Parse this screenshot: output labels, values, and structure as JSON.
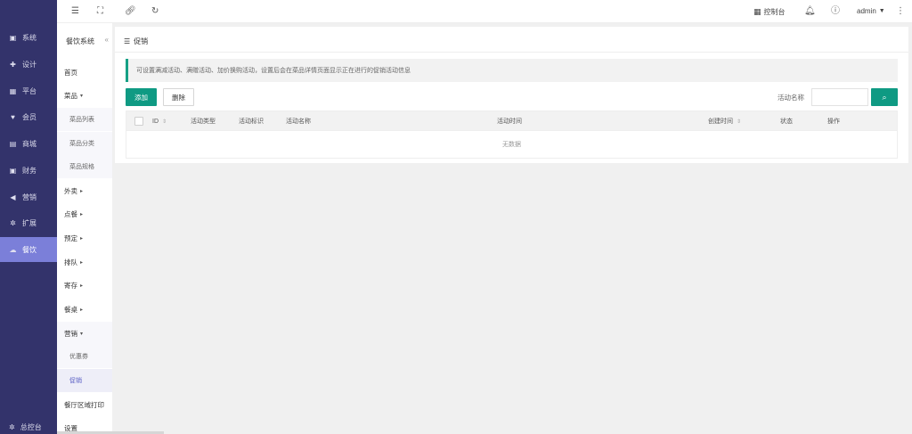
{
  "leftnav": {
    "items": [
      {
        "label": "系统",
        "icon": "monitor-icon"
      },
      {
        "label": "设计",
        "icon": "puzzle-icon"
      },
      {
        "label": "平台",
        "icon": "grid-icon"
      },
      {
        "label": "会员",
        "icon": "heart-icon"
      },
      {
        "label": "商城",
        "icon": "shop-icon"
      },
      {
        "label": "财务",
        "icon": "wallet-icon"
      },
      {
        "label": "营销",
        "icon": "megaphone-icon"
      },
      {
        "label": "扩展",
        "icon": "gear-icon"
      },
      {
        "label": "餐饮",
        "icon": "cloud-icon"
      }
    ],
    "active_index": 8,
    "bottom_label": "总控台"
  },
  "subnav": {
    "title": "餐饮系统",
    "collapse": "«",
    "items": [
      {
        "label": "首页",
        "type": "item"
      },
      {
        "label": "菜品",
        "type": "group",
        "caret": "▾"
      },
      {
        "label": "菜品列表",
        "type": "child"
      },
      {
        "label": "菜品分类",
        "type": "child"
      },
      {
        "label": "菜品规格",
        "type": "child"
      },
      {
        "label": "外卖",
        "type": "group",
        "caret": "▸"
      },
      {
        "label": "点餐",
        "type": "group",
        "caret": "▸"
      },
      {
        "label": "预定",
        "type": "group",
        "caret": "▸"
      },
      {
        "label": "排队",
        "type": "group",
        "caret": "▸"
      },
      {
        "label": "寄存",
        "type": "group",
        "caret": "▸"
      },
      {
        "label": "餐桌",
        "type": "group",
        "caret": "▸"
      },
      {
        "label": "营销",
        "type": "group",
        "caret": "▾"
      },
      {
        "label": "优惠券",
        "type": "child"
      },
      {
        "label": "促销",
        "type": "child",
        "active": true
      },
      {
        "label": "餐厅区域打印",
        "type": "item"
      },
      {
        "label": "设置",
        "type": "item"
      }
    ]
  },
  "topbar": {
    "console_label": "控制台",
    "user": "admin"
  },
  "panel": {
    "title": "促销",
    "notice": "可设置满减活动、满赠活动、加价换购活动，设置后会在菜品详情页面显示正在进行的促销活动信息",
    "add_label": "添加",
    "delete_label": "删除",
    "search_label": "活动名称",
    "search_value": "",
    "table": {
      "columns": [
        "ID",
        "活动类型",
        "活动标识",
        "活动名称",
        "活动时间",
        "创建时间",
        "状态",
        "操作"
      ],
      "empty_text": "无数据"
    }
  },
  "colors": {
    "nav_bg": "#33336b",
    "nav_active": "#7b7fd9",
    "primary": "#0f9a83"
  }
}
